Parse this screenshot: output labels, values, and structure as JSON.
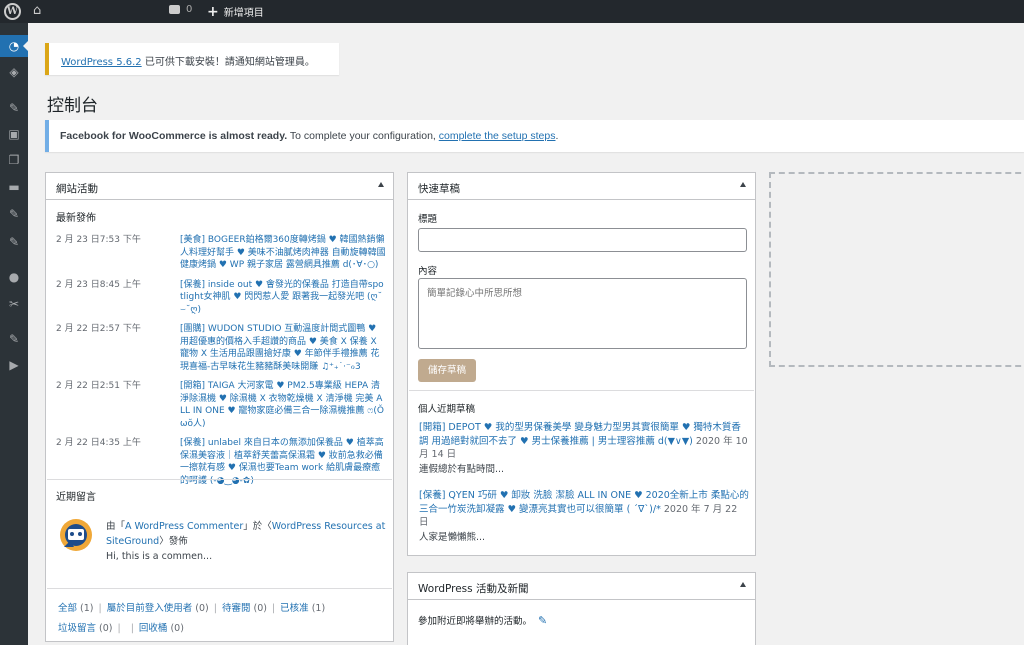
{
  "admin_bar": {
    "wp_logo": "W",
    "comments_count": "0",
    "new_label": "新增項目"
  },
  "sidebar": {
    "items": [
      {
        "icon": "dashboard-icon",
        "glyph": "◔"
      },
      {
        "icon": "layers-icon",
        "glyph": "◈"
      },
      {
        "icon": "pin-icon",
        "glyph": "✎"
      },
      {
        "icon": "media-icon",
        "glyph": "▣"
      },
      {
        "icon": "pages-icon",
        "glyph": "❐"
      },
      {
        "icon": "comments-icon",
        "glyph": "▬"
      },
      {
        "icon": "pin-icon",
        "glyph": "✎"
      },
      {
        "icon": "pin-icon",
        "glyph": "✎"
      },
      {
        "icon": "users-icon",
        "glyph": "●"
      },
      {
        "icon": "tools-icon",
        "glyph": "✂"
      },
      {
        "icon": "pin-icon",
        "glyph": "✎"
      },
      {
        "icon": "play-icon",
        "glyph": "▶"
      }
    ]
  },
  "notices": {
    "update": {
      "link": "WordPress 5.6.2",
      "text": " 已可供下載安裝！請通知網站管理員。"
    },
    "facebook": {
      "bold": "Facebook for WooCommerce is almost ready.",
      "text": " To complete your configuration, ",
      "link": "complete the setup steps",
      "end": "."
    }
  },
  "page_title": "控制台",
  "activity": {
    "title": "網站活動",
    "recent_published_title": "最新發佈",
    "items": [
      {
        "date": "2 月 23 日7:53 下午",
        "title": "[美食] BOGEER鉑格爾360度轉烤鍋 ♥ 韓國熱銷懶人料理好幫手 ♥ 美味不油膩烤肉神器 自動旋轉韓國健康烤鍋 ♥ WP 親子家居 露營網具推薦 d(･∀･○)"
      },
      {
        "date": "2 月 23 日8:45 上午",
        "title": "[保養] inside out ♥ 會發光的保養品 打造自帶spotlight女神肌 ♥ 閃閃惹人愛 跟著我一起發光吧 (ღ˘⌣˘ღ)"
      },
      {
        "date": "2 月 22 日2:57 下午",
        "title": "[團購] WUDON STUDIO 互動溫度計間式圖鴨 ♥ 用超優惠的價格入手超讚的商品 ♥ 美食 X 保養 X 寵物 X 生活用品跟團搶好康 ♥ 年節伴手禮推薦 花現喜福-古早味花生豬豬酥美味開賺 ♫⁺₊˙·⁻ℴ3"
      },
      {
        "date": "2 月 22 日2:51 下午",
        "title": "[開箱] TAIGA 大河家電 ♥ PM2.5專業級 HEPA 清淨除濕機 ♥ 除濕機 X 衣物乾燥機 X 清淨機 完美 ALL IN ONE ♥ 寵物家庭必備三合一除濕機推薦 ෆ(Ŏωŏ人)"
      },
      {
        "date": "2 月 22 日4:35 上午",
        "title": "[保養] unlabel 來自日本の無添加保養品 ♥ 植萃高保濕美容液｜植萃舒芙蕾高保濕霜 ♥ 妝前急救必備 一擦就有感 ♥ 保濕也要Team work 給肌膚最療癒的呵護 (-◕‿◕-✿)"
      }
    ],
    "recent_comments_title": "近期留言",
    "comment": {
      "prefix": "由「",
      "author": "A WordPress Commenter",
      "mid": "」於〈",
      "post": "WordPress Resources at SiteGround",
      "suffix": "〉發佈",
      "excerpt": "Hi, this is a commen..."
    },
    "comment_links": [
      {
        "label": "全部",
        "count": "(1)"
      },
      {
        "label": "屬於目前登入使用者",
        "count": "(0)"
      },
      {
        "label": "待審閱",
        "count": "(0)"
      },
      {
        "label": "已核准",
        "count": "(1)"
      },
      {
        "label": "垃圾留言",
        "count": "(0)"
      },
      {
        "label": "回收桶",
        "count": "(0)"
      }
    ]
  },
  "quick_draft": {
    "title": "快速草稿",
    "title_label": "標題",
    "content_label": "內容",
    "content_placeholder": "簡單記錄心中所思所想",
    "save_label": "儲存草稿",
    "drafts_title": "個人近期草稿",
    "drafts": [
      {
        "title": "[開箱] DEPOT ♥ 我的型男保養美學 變身魅力型男其實很簡單 ♥ 獨特木質香調 用過絕對就回不去了 ♥ 男士保養推薦 | 男士理容推薦 d(▼∨▼)",
        "date": "2020 年 10 月 14 日",
        "excerpt": "連假總於有點時間..."
      },
      {
        "title": "[保養] QYEN 巧研 ♥ 卸妝 洗臉 潔臉 ALL IN ONE ♥ 2020全新上市 柔點心的三合一竹炭洗卸凝露 ♥ 變漂亮其實也可以很簡單 ( ´∇`)/*",
        "date": "2020 年 7 月 22 日",
        "excerpt": "人家是懶懶熊..."
      }
    ]
  },
  "events": {
    "title": "WordPress 活動及新聞",
    "text": "參加附近即將舉辦的活動。"
  }
}
